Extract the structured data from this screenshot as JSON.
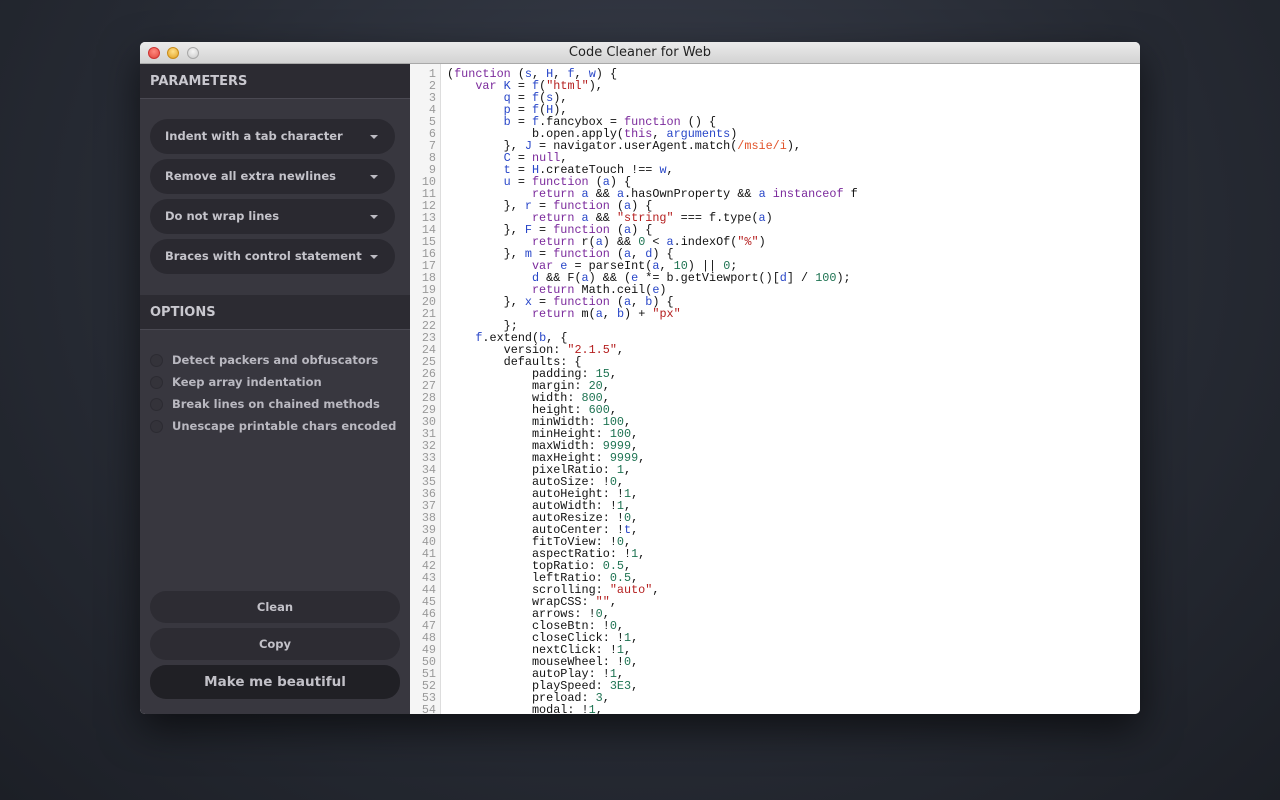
{
  "window": {
    "title": "Code Cleaner for Web"
  },
  "sidebar": {
    "parameters_title": "PARAMETERS",
    "dropdowns": [
      {
        "label": "Indent with a tab character"
      },
      {
        "label": "Remove all extra newlines"
      },
      {
        "label": "Do not wrap lines"
      },
      {
        "label": "Braces with control statement"
      }
    ],
    "options_title": "OPTIONS",
    "options": [
      {
        "label": "Detect packers and obfuscators",
        "checked": false
      },
      {
        "label": "Keep array indentation",
        "checked": false
      },
      {
        "label": "Break lines on chained methods",
        "checked": false
      },
      {
        "label": "Unescape printable chars encoded",
        "checked": false
      }
    ],
    "buttons": {
      "clean": "Clean",
      "copy": "Copy",
      "beautify": "Make me beautiful"
    }
  },
  "colors": {
    "keyword": "#7b2a9c",
    "variable": "#2846c8",
    "string": "#b52020",
    "number": "#1e7352",
    "regex": "#e2542b"
  },
  "code": [
    [
      [
        "p",
        "("
      ],
      [
        "k",
        "function"
      ],
      [
        "p",
        " ("
      ],
      [
        "v",
        "s"
      ],
      [
        "p",
        ", "
      ],
      [
        "v",
        "H"
      ],
      [
        "p",
        ", "
      ],
      [
        "v",
        "f"
      ],
      [
        "p",
        ", "
      ],
      [
        "v",
        "w"
      ],
      [
        "p",
        ") {"
      ]
    ],
    [
      [
        "p",
        "    "
      ],
      [
        "k",
        "var"
      ],
      [
        "p",
        " "
      ],
      [
        "v",
        "K"
      ],
      [
        "p",
        " = "
      ],
      [
        "v",
        "f"
      ],
      [
        "p",
        "("
      ],
      [
        "s",
        "\"html\""
      ],
      [
        "p",
        "),"
      ]
    ],
    [
      [
        "p",
        "        "
      ],
      [
        "v",
        "q"
      ],
      [
        "p",
        " = "
      ],
      [
        "v",
        "f"
      ],
      [
        "p",
        "("
      ],
      [
        "v",
        "s"
      ],
      [
        "p",
        "),"
      ]
    ],
    [
      [
        "p",
        "        "
      ],
      [
        "v",
        "p"
      ],
      [
        "p",
        " = "
      ],
      [
        "v",
        "f"
      ],
      [
        "p",
        "("
      ],
      [
        "v",
        "H"
      ],
      [
        "p",
        "),"
      ]
    ],
    [
      [
        "p",
        "        "
      ],
      [
        "v",
        "b"
      ],
      [
        "p",
        " = "
      ],
      [
        "v",
        "f"
      ],
      [
        "p",
        ".fancybox = "
      ],
      [
        "k",
        "function"
      ],
      [
        "p",
        " () {"
      ]
    ],
    [
      [
        "p",
        "            b.open.apply("
      ],
      [
        "k",
        "this"
      ],
      [
        "p",
        ", "
      ],
      [
        "v",
        "arguments"
      ],
      [
        "p",
        ")"
      ]
    ],
    [
      [
        "p",
        "        }, "
      ],
      [
        "v",
        "J"
      ],
      [
        "p",
        " = navigator.userAgent.match("
      ],
      [
        "r",
        "/msie/i"
      ],
      [
        "p",
        "),"
      ]
    ],
    [
      [
        "p",
        "        "
      ],
      [
        "v",
        "C"
      ],
      [
        "p",
        " = "
      ],
      [
        "k",
        "null"
      ],
      [
        "p",
        ","
      ]
    ],
    [
      [
        "p",
        "        "
      ],
      [
        "v",
        "t"
      ],
      [
        "p",
        " = "
      ],
      [
        "v",
        "H"
      ],
      [
        "p",
        ".createTouch !== "
      ],
      [
        "v",
        "w"
      ],
      [
        "p",
        ","
      ]
    ],
    [
      [
        "p",
        "        "
      ],
      [
        "v",
        "u"
      ],
      [
        "p",
        " = "
      ],
      [
        "k",
        "function"
      ],
      [
        "p",
        " ("
      ],
      [
        "v",
        "a"
      ],
      [
        "p",
        ") {"
      ]
    ],
    [
      [
        "p",
        "            "
      ],
      [
        "k",
        "return"
      ],
      [
        "p",
        " "
      ],
      [
        "v",
        "a"
      ],
      [
        "p",
        " && "
      ],
      [
        "v",
        "a"
      ],
      [
        "p",
        ".hasOwnProperty && "
      ],
      [
        "v",
        "a"
      ],
      [
        "p",
        " "
      ],
      [
        "k",
        "instanceof"
      ],
      [
        "p",
        " f"
      ]
    ],
    [
      [
        "p",
        "        }, "
      ],
      [
        "v",
        "r"
      ],
      [
        "p",
        " = "
      ],
      [
        "k",
        "function"
      ],
      [
        "p",
        " ("
      ],
      [
        "v",
        "a"
      ],
      [
        "p",
        ") {"
      ]
    ],
    [
      [
        "p",
        "            "
      ],
      [
        "k",
        "return"
      ],
      [
        "p",
        " "
      ],
      [
        "v",
        "a"
      ],
      [
        "p",
        " && "
      ],
      [
        "s",
        "\"string\""
      ],
      [
        "p",
        " === f.type("
      ],
      [
        "v",
        "a"
      ],
      [
        "p",
        ")"
      ]
    ],
    [
      [
        "p",
        "        }, "
      ],
      [
        "v",
        "F"
      ],
      [
        "p",
        " = "
      ],
      [
        "k",
        "function"
      ],
      [
        "p",
        " ("
      ],
      [
        "v",
        "a"
      ],
      [
        "p",
        ") {"
      ]
    ],
    [
      [
        "p",
        "            "
      ],
      [
        "k",
        "return"
      ],
      [
        "p",
        " r("
      ],
      [
        "v",
        "a"
      ],
      [
        "p",
        ") && "
      ],
      [
        "n",
        "0"
      ],
      [
        "p",
        " < "
      ],
      [
        "v",
        "a"
      ],
      [
        "p",
        ".indexOf("
      ],
      [
        "s",
        "\"%\""
      ],
      [
        "p",
        ")"
      ]
    ],
    [
      [
        "p",
        "        }, "
      ],
      [
        "v",
        "m"
      ],
      [
        "p",
        " = "
      ],
      [
        "k",
        "function"
      ],
      [
        "p",
        " ("
      ],
      [
        "v",
        "a"
      ],
      [
        "p",
        ", "
      ],
      [
        "v",
        "d"
      ],
      [
        "p",
        ") {"
      ]
    ],
    [
      [
        "p",
        "            "
      ],
      [
        "k",
        "var"
      ],
      [
        "p",
        " "
      ],
      [
        "v",
        "e"
      ],
      [
        "p",
        " = parseInt("
      ],
      [
        "v",
        "a"
      ],
      [
        "p",
        ", "
      ],
      [
        "n",
        "10"
      ],
      [
        "p",
        ") || "
      ],
      [
        "n",
        "0"
      ],
      [
        "p",
        ";"
      ]
    ],
    [
      [
        "p",
        "            "
      ],
      [
        "v",
        "d"
      ],
      [
        "p",
        " && F("
      ],
      [
        "v",
        "a"
      ],
      [
        "p",
        ") && ("
      ],
      [
        "v",
        "e"
      ],
      [
        "p",
        " *= b.getViewport()["
      ],
      [
        "v",
        "d"
      ],
      [
        "p",
        "] / "
      ],
      [
        "n",
        "100"
      ],
      [
        "p",
        ");"
      ]
    ],
    [
      [
        "p",
        "            "
      ],
      [
        "k",
        "return"
      ],
      [
        "p",
        " Math.ceil("
      ],
      [
        "v",
        "e"
      ],
      [
        "p",
        ")"
      ]
    ],
    [
      [
        "p",
        "        }, "
      ],
      [
        "v",
        "x"
      ],
      [
        "p",
        " = "
      ],
      [
        "k",
        "function"
      ],
      [
        "p",
        " ("
      ],
      [
        "v",
        "a"
      ],
      [
        "p",
        ", "
      ],
      [
        "v",
        "b"
      ],
      [
        "p",
        ") {"
      ]
    ],
    [
      [
        "p",
        "            "
      ],
      [
        "k",
        "return"
      ],
      [
        "p",
        " m("
      ],
      [
        "v",
        "a"
      ],
      [
        "p",
        ", "
      ],
      [
        "v",
        "b"
      ],
      [
        "p",
        ") + "
      ],
      [
        "s",
        "\"px\""
      ]
    ],
    [
      [
        "p",
        "        };"
      ]
    ],
    [
      [
        "p",
        "    "
      ],
      [
        "v",
        "f"
      ],
      [
        "p",
        ".extend("
      ],
      [
        "v",
        "b"
      ],
      [
        "p",
        ", {"
      ]
    ],
    [
      [
        "p",
        "        version: "
      ],
      [
        "s",
        "\"2.1.5\""
      ],
      [
        "p",
        ","
      ]
    ],
    [
      [
        "p",
        "        defaults: {"
      ]
    ],
    [
      [
        "p",
        "            padding: "
      ],
      [
        "n",
        "15"
      ],
      [
        "p",
        ","
      ]
    ],
    [
      [
        "p",
        "            margin: "
      ],
      [
        "n",
        "20"
      ],
      [
        "p",
        ","
      ]
    ],
    [
      [
        "p",
        "            width: "
      ],
      [
        "n",
        "800"
      ],
      [
        "p",
        ","
      ]
    ],
    [
      [
        "p",
        "            height: "
      ],
      [
        "n",
        "600"
      ],
      [
        "p",
        ","
      ]
    ],
    [
      [
        "p",
        "            minWidth: "
      ],
      [
        "n",
        "100"
      ],
      [
        "p",
        ","
      ]
    ],
    [
      [
        "p",
        "            minHeight: "
      ],
      [
        "n",
        "100"
      ],
      [
        "p",
        ","
      ]
    ],
    [
      [
        "p",
        "            maxWidth: "
      ],
      [
        "n",
        "9999"
      ],
      [
        "p",
        ","
      ]
    ],
    [
      [
        "p",
        "            maxHeight: "
      ],
      [
        "n",
        "9999"
      ],
      [
        "p",
        ","
      ]
    ],
    [
      [
        "p",
        "            pixelRatio: "
      ],
      [
        "n",
        "1"
      ],
      [
        "p",
        ","
      ]
    ],
    [
      [
        "p",
        "            autoSize: !"
      ],
      [
        "n",
        "0"
      ],
      [
        "p",
        ","
      ]
    ],
    [
      [
        "p",
        "            autoHeight: !"
      ],
      [
        "n",
        "1"
      ],
      [
        "p",
        ","
      ]
    ],
    [
      [
        "p",
        "            autoWidth: !"
      ],
      [
        "n",
        "1"
      ],
      [
        "p",
        ","
      ]
    ],
    [
      [
        "p",
        "            autoResize: !"
      ],
      [
        "n",
        "0"
      ],
      [
        "p",
        ","
      ]
    ],
    [
      [
        "p",
        "            autoCenter: !"
      ],
      [
        "v",
        "t"
      ],
      [
        "p",
        ","
      ]
    ],
    [
      [
        "p",
        "            fitToView: !"
      ],
      [
        "n",
        "0"
      ],
      [
        "p",
        ","
      ]
    ],
    [
      [
        "p",
        "            aspectRatio: !"
      ],
      [
        "n",
        "1"
      ],
      [
        "p",
        ","
      ]
    ],
    [
      [
        "p",
        "            topRatio: "
      ],
      [
        "n",
        "0.5"
      ],
      [
        "p",
        ","
      ]
    ],
    [
      [
        "p",
        "            leftRatio: "
      ],
      [
        "n",
        "0.5"
      ],
      [
        "p",
        ","
      ]
    ],
    [
      [
        "p",
        "            scrolling: "
      ],
      [
        "s",
        "\"auto\""
      ],
      [
        "p",
        ","
      ]
    ],
    [
      [
        "p",
        "            wrapCSS: "
      ],
      [
        "s",
        "\"\""
      ],
      [
        "p",
        ","
      ]
    ],
    [
      [
        "p",
        "            arrows: !"
      ],
      [
        "n",
        "0"
      ],
      [
        "p",
        ","
      ]
    ],
    [
      [
        "p",
        "            closeBtn: !"
      ],
      [
        "n",
        "0"
      ],
      [
        "p",
        ","
      ]
    ],
    [
      [
        "p",
        "            closeClick: !"
      ],
      [
        "n",
        "1"
      ],
      [
        "p",
        ","
      ]
    ],
    [
      [
        "p",
        "            nextClick: !"
      ],
      [
        "n",
        "1"
      ],
      [
        "p",
        ","
      ]
    ],
    [
      [
        "p",
        "            mouseWheel: !"
      ],
      [
        "n",
        "0"
      ],
      [
        "p",
        ","
      ]
    ],
    [
      [
        "p",
        "            autoPlay: !"
      ],
      [
        "n",
        "1"
      ],
      [
        "p",
        ","
      ]
    ],
    [
      [
        "p",
        "            playSpeed: "
      ],
      [
        "n",
        "3E3"
      ],
      [
        "p",
        ","
      ]
    ],
    [
      [
        "p",
        "            preload: "
      ],
      [
        "n",
        "3"
      ],
      [
        "p",
        ","
      ]
    ],
    [
      [
        "p",
        "            modal: !"
      ],
      [
        "n",
        "1"
      ],
      [
        "p",
        ","
      ]
    ]
  ]
}
